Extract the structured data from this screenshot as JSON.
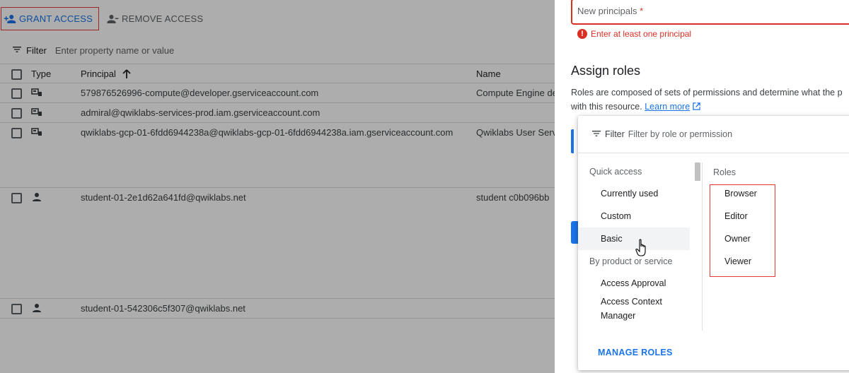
{
  "toolbar": {
    "grant_label": "GRANT ACCESS",
    "remove_label": "REMOVE ACCESS"
  },
  "filter": {
    "label": "Filter",
    "placeholder": "Enter property name or value"
  },
  "table": {
    "headers": {
      "type": "Type",
      "principal": "Principal",
      "name": "Name"
    },
    "rows": [
      {
        "type_icon": "service-account-icon",
        "principal": "579876526996-compute@developer.gserviceaccount.com",
        "name": "Compute Engine de"
      },
      {
        "type_icon": "service-account-icon",
        "principal": "admiral@qwiklabs-services-prod.iam.gserviceaccount.com",
        "name": ""
      },
      {
        "type_icon": "service-account-icon",
        "principal": "qwiklabs-gcp-01-6fdd6944238a@qwiklabs-gcp-01-6fdd6944238a.iam.gserviceaccount.com",
        "name": "Qwiklabs User Serv"
      },
      {
        "type_icon": "person-icon",
        "principal": "student-01-2e1d62a641fd@qwiklabs.net",
        "name": "student c0b096bb"
      },
      {
        "type_icon": "person-icon",
        "principal": "student-01-542306c5f307@qwiklabs.net",
        "name": ""
      }
    ]
  },
  "panel": {
    "principals_label": "New principals",
    "required_mark": "*",
    "error_text": "Enter at least one principal",
    "assign_title": "Assign roles",
    "assign_desc_line1": "Roles are composed of sets of permissions and determine what the p",
    "assign_desc_line2": "with this resource.",
    "learn_more": "Learn more"
  },
  "picker": {
    "filter_label": "Filter",
    "filter_placeholder": "Filter by role or permission",
    "quick_access_header": "Quick access",
    "quick_items": [
      "Currently used",
      "Custom",
      "Basic"
    ],
    "active_item": "Basic",
    "product_header": "By product or service",
    "product_items": [
      "Access Approval",
      "Access Context Manager"
    ],
    "roles_header": "Roles",
    "roles": [
      "Browser",
      "Editor",
      "Owner",
      "Viewer"
    ],
    "manage_roles": "MANAGE ROLES"
  },
  "colors": {
    "primary": "#1a73e8",
    "error": "#d93025",
    "highlight_box": "#e53935"
  }
}
